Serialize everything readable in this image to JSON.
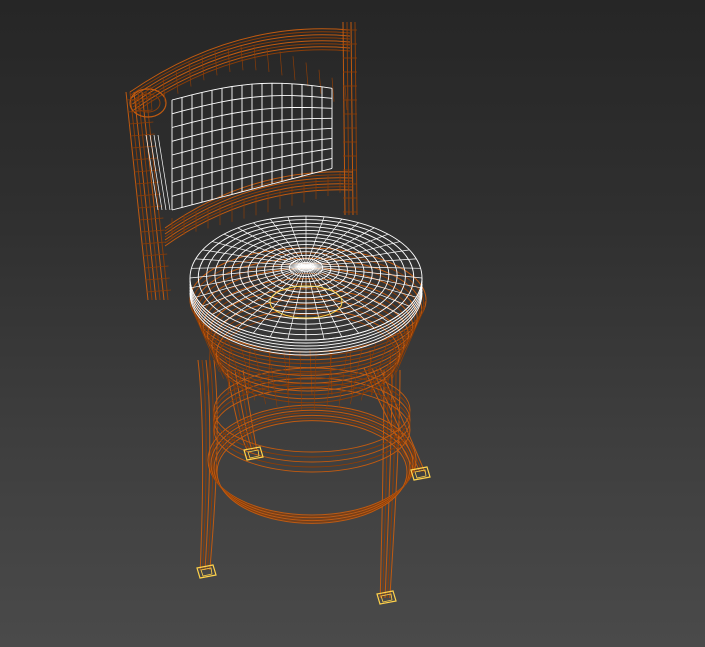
{
  "scene": {
    "object": "swivel-bar-stool",
    "render_mode": "wireframe",
    "colors": {
      "background_top": "#262626",
      "background_bottom": "#4a4a4a",
      "frame_wire": "#c05a10",
      "frame_wire_dark": "#8a3d08",
      "seat_wire": "#ffffff",
      "back_panel_wire": "#ffffff",
      "foot_cap_wire": "#ffd24a"
    }
  }
}
